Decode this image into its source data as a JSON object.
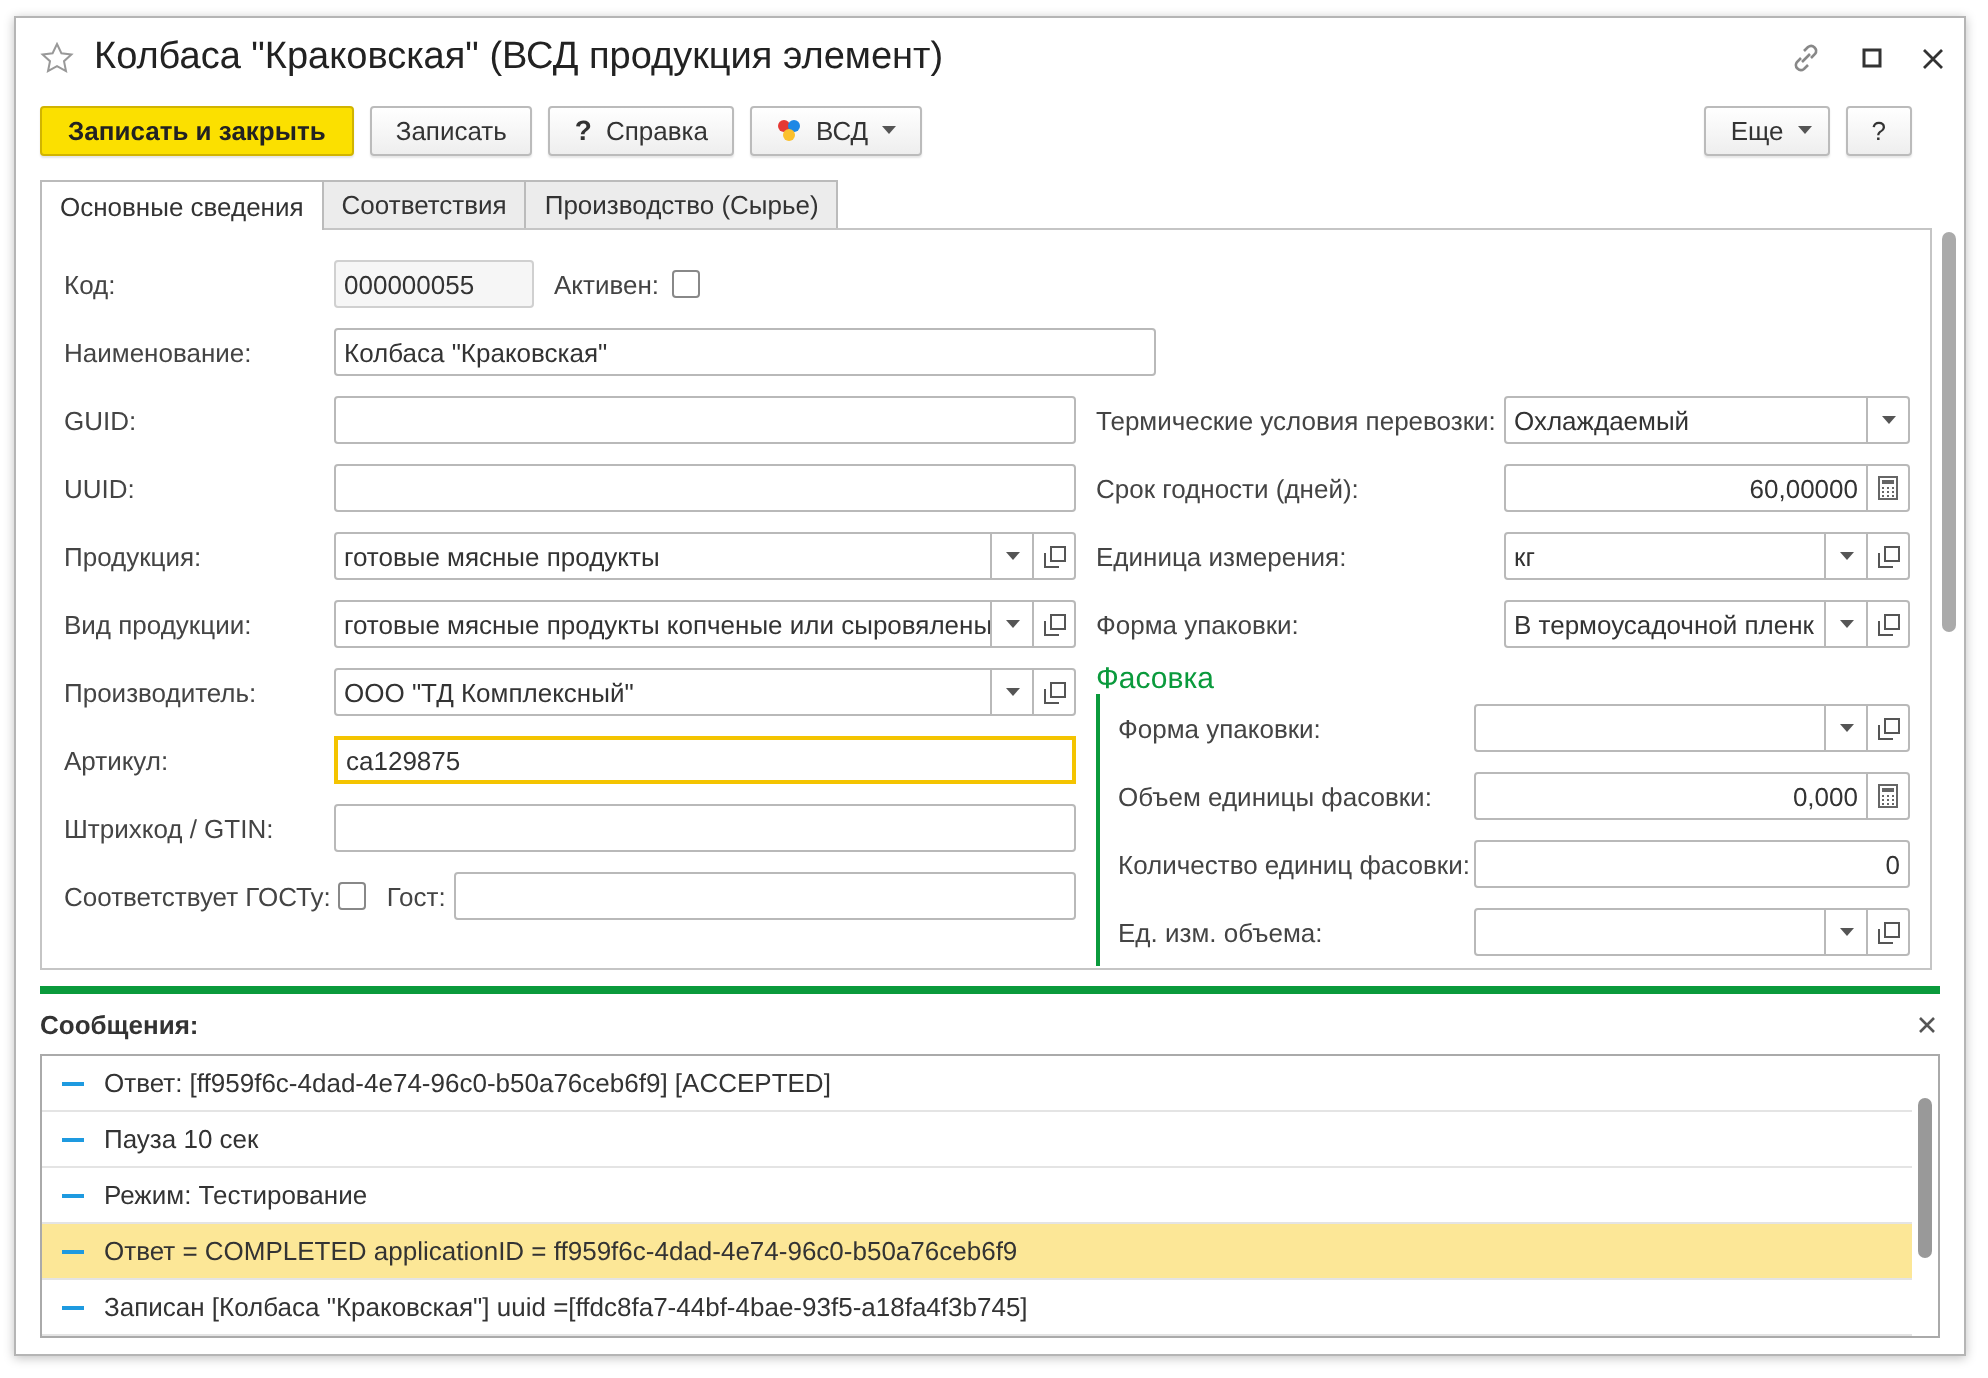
{
  "window": {
    "title": "Колбаса \"Краковская\" (ВСД продукция элемент)"
  },
  "toolbar": {
    "buttons": [
      {
        "label": "Записать и закрыть",
        "kind": "primary"
      },
      {
        "label": "Записать",
        "kind": "plain"
      },
      {
        "label": "Справка",
        "kind": "help",
        "icon": "?"
      },
      {
        "label": "ВСД",
        "kind": "logo_menu"
      }
    ],
    "right_buttons": [
      {
        "label": "Еще",
        "kind": "menu"
      },
      {
        "label": "?",
        "kind": "plain"
      }
    ]
  },
  "tabs": [
    {
      "label": "Основные сведения",
      "selected": true
    },
    {
      "label": "Соответствия",
      "selected": false
    },
    {
      "label": "Производство (Сырье)",
      "selected": false
    }
  ],
  "form": {
    "top_rows": [
      {
        "kind": "code",
        "label": "Код:",
        "value": "000000055",
        "check_label": "Активен:",
        "checked": false
      },
      {
        "kind": "wide",
        "label": "Наименование:",
        "value": "Колбаса \"Краковская\""
      }
    ],
    "left_rows": [
      {
        "kind": "text",
        "label": "GUID:",
        "focused": false
      },
      {
        "kind": "text",
        "label": "UUID:",
        "focused": false
      },
      {
        "kind": "select_open",
        "label": "Продукция:",
        "value": "готовые мясные продукты"
      },
      {
        "kind": "select_open",
        "label": "Вид продукции:",
        "value": "готовые мясные продукты копченые или сыровялены"
      },
      {
        "kind": "select_open",
        "label": "Производитель:",
        "value": "ООО \"ТД Комплексный\""
      },
      {
        "kind": "text",
        "label": "Артикул:",
        "value": "ca129875",
        "focused": true
      },
      {
        "kind": "text",
        "label": "Штрихкод / GTIN:",
        "focused": false
      },
      {
        "kind": "check_text",
        "label": "Соответствует ГОСТу:",
        "checked": false,
        "text_label": "Гост:"
      }
    ],
    "right_rows": [
      {
        "kind": "select",
        "label": "Термические условия перевозки:",
        "value": "Охлаждаемый"
      },
      {
        "kind": "number_calc",
        "label": "Срок годности (дней):",
        "value": "60,00000"
      },
      {
        "kind": "select_open",
        "label": "Единица измерения:",
        "value": "кг"
      },
      {
        "kind": "select_open",
        "label": "Форма упаковки:",
        "value": "В термоусадочной пленк"
      }
    ],
    "packing": {
      "title": "Фасовка",
      "rows": [
        {
          "kind": "select_open",
          "label": "Форма упаковки:"
        },
        {
          "kind": "number_calc",
          "label": "Объем единицы фасовки:",
          "value": "0,000"
        },
        {
          "kind": "number",
          "label": "Количество единиц фасовки:",
          "value": "0"
        },
        {
          "kind": "select_open",
          "label": "Ед. изм. объема:"
        }
      ]
    }
  },
  "messages": {
    "title": "Сообщения:",
    "items": [
      {
        "text": "Ответ: [ff959f6c-4dad-4e74-96c0-b50a76ceb6f9] [ACCEPTED]",
        "selected": false
      },
      {
        "text": "Пауза 10 сек",
        "selected": false
      },
      {
        "text": "Режим: Тестирование",
        "selected": false
      },
      {
        "text": "Ответ = COMPLETED applicationID = ff959f6c-4dad-4e74-96c0-b50a76ceb6f9",
        "selected": true
      },
      {
        "text": "Записан [Колбаса \"Краковская\"] uuid =[ffdc8fa7-44bf-4bae-93f5-a18fa4f3b745]",
        "selected": false
      }
    ]
  }
}
